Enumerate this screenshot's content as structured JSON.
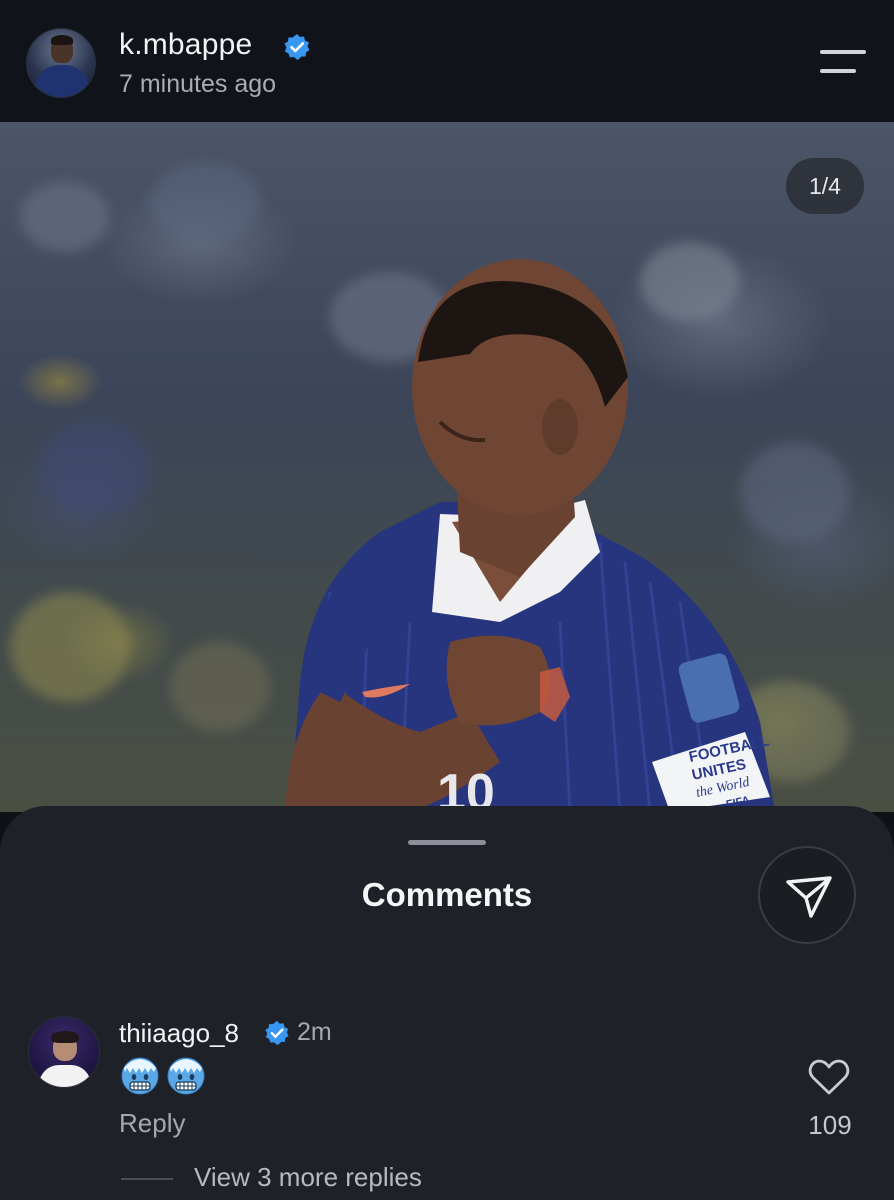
{
  "header": {
    "username": "k.mbappe",
    "timestamp": "7 minutes ago"
  },
  "photo": {
    "counter": "1/4",
    "jersey_number": "10",
    "armband_text": [
      "FOOTBALL",
      "UNITES",
      "the World",
      "FIFA"
    ]
  },
  "comments_sheet": {
    "title": "Comments",
    "comment": {
      "username": "thiiaago_8",
      "time": "2m",
      "emojis": [
        "freezing-face",
        "freezing-face"
      ],
      "reply_label": "Reply",
      "like_count": "109",
      "view_replies_label": "View 3 more replies"
    }
  },
  "colors": {
    "background": "#10131a",
    "sheet": "#1f2128",
    "verified_blue": "#3897f0",
    "jersey_blue": "#2a3b8c"
  }
}
